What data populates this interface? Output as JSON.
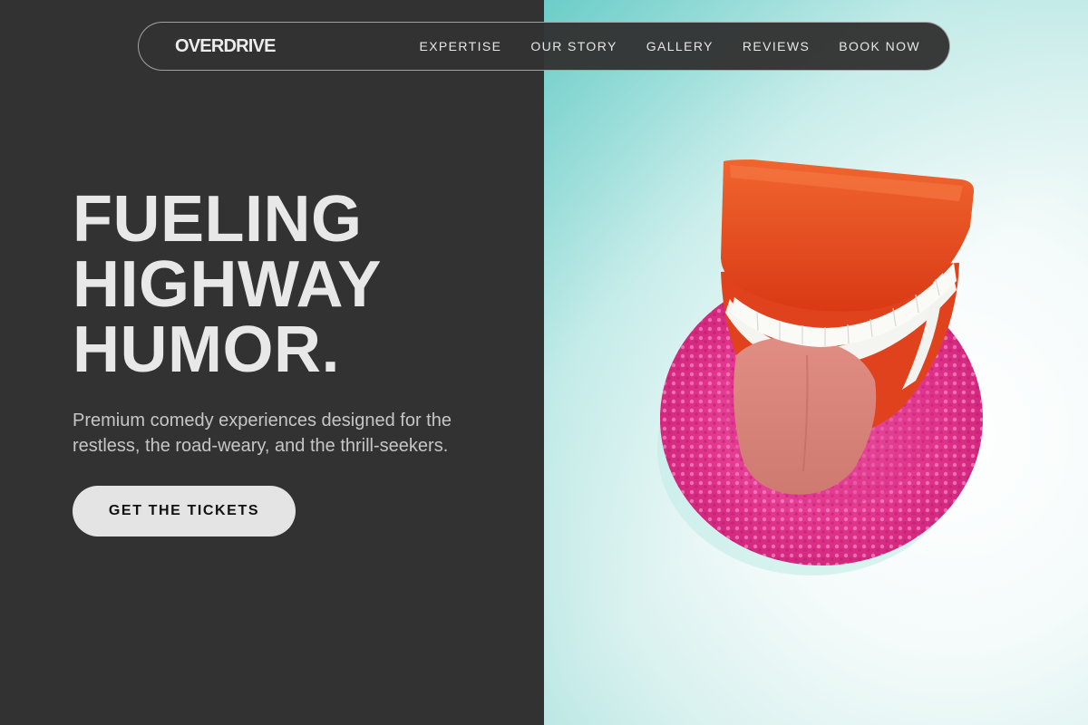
{
  "nav": {
    "logo": "OVERDRIVE",
    "links": [
      "EXPERTISE",
      "OUR STORY",
      "GALLERY",
      "REVIEWS",
      "BOOK NOW"
    ]
  },
  "hero": {
    "title_lines": [
      "FUELING",
      "HIGHWAY",
      "HUMOR."
    ],
    "subtitle": "Premium comedy experiences designed for the restless, the road-weary, and the thrill-seekers.",
    "cta_label": "GET THE TICKETS"
  },
  "image": {
    "subject": "wind-up chattering teeth toy with tongue on pink scrubber sponge"
  },
  "colors": {
    "panel_dark": "#323232",
    "text_light": "#e8e8e8",
    "button_bg": "#e4e4e4",
    "teeth_red": "#e8461f",
    "sponge_pink": "#e2358e",
    "background_teal": "#a6e0dc"
  }
}
